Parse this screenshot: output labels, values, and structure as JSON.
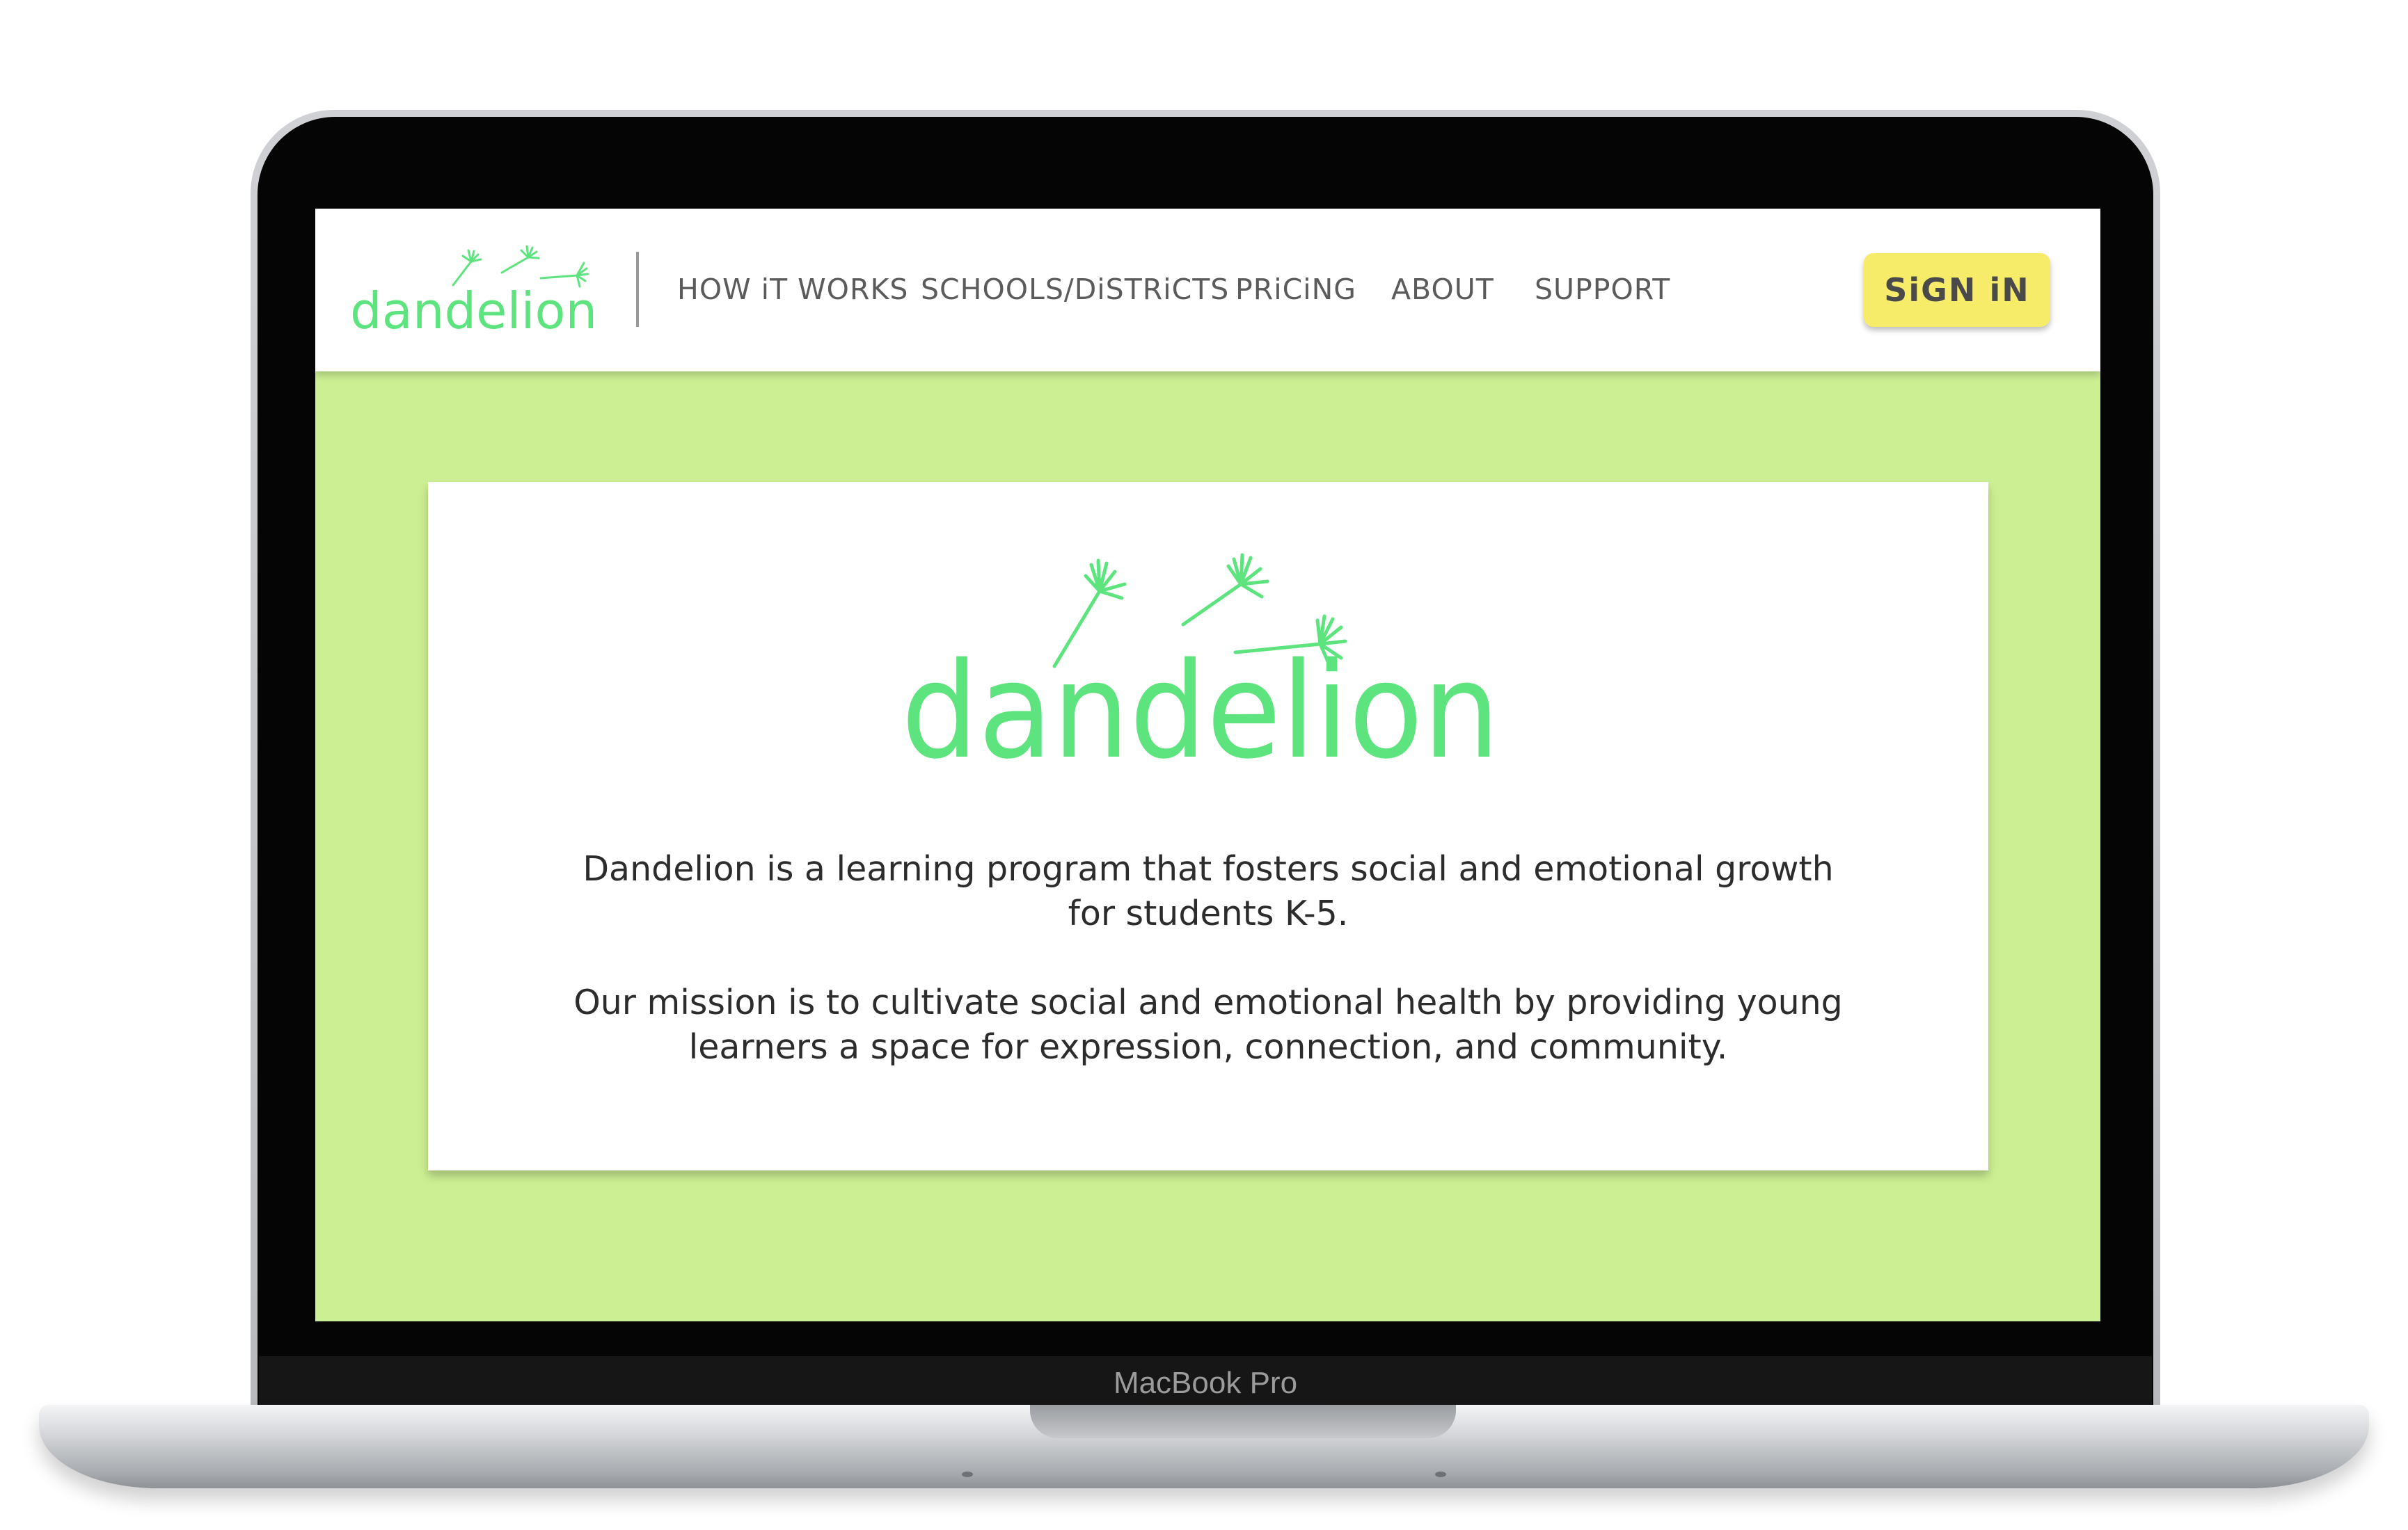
{
  "device": {
    "label": "MacBook Pro"
  },
  "header": {
    "logo_text": "dandelion",
    "nav": [
      {
        "label": "HOW iT WORKS"
      },
      {
        "label": "SCHOOLS/DiSTRiCTS"
      },
      {
        "label": "PRiCiNG"
      },
      {
        "label": "ABOUT"
      },
      {
        "label": "SUPPORT"
      }
    ],
    "signin_label": "SiGN iN"
  },
  "hero": {
    "logo_text": "dandelion",
    "paragraph1_line1": "Dandelion is a learning program that fosters social and emotional growth",
    "paragraph1_line2": "for students K-5.",
    "paragraph2_line1": "Our mission is to cultivate social and emotional health by providing young",
    "paragraph2_line2": "learners a space for expression, connection, and community."
  },
  "colors": {
    "brand_green": "#5ee47e",
    "page_background": "#ccef93",
    "signin_yellow": "#f7ec6a",
    "nav_text": "#5b5b5b"
  }
}
